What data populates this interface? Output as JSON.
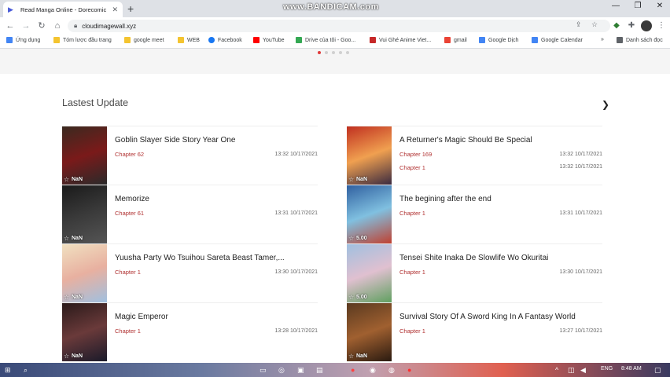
{
  "browser": {
    "tab_title": "Read Manga Online - Dorecomic",
    "new_tab_label": "+",
    "recorder_watermark": "www.BANDICAM.com",
    "url": "cloudimagewall.xyz",
    "bookmarks": [
      {
        "label": "Ứng dụng",
        "color": "#4285f4"
      },
      {
        "label": "Tóm lược đầu trang",
        "color": "#f4c430"
      },
      {
        "label": "google meet",
        "color": "#f4c430"
      },
      {
        "label": "WEB",
        "color": "#f4c430"
      },
      {
        "label": "Facebook",
        "color": "#1877f2"
      },
      {
        "label": "YouTube",
        "color": "#ff0000"
      },
      {
        "label": "Drive của tôi - Goo...",
        "color": "#34a853"
      },
      {
        "label": "Vui Ghé Anime Viet...",
        "color": "#c62828"
      },
      {
        "label": "gmail",
        "color": "#ea4335"
      },
      {
        "label": "Google Dịch",
        "color": "#4285f4"
      },
      {
        "label": "Google Calendar",
        "color": "#4285f4"
      }
    ],
    "bookmarks_overflow": "»",
    "reading_list": "Danh sách đọc"
  },
  "page": {
    "section_title": "Lastest Update",
    "carousel_active_index": 0,
    "carousel_dot_count": 5,
    "left_items": [
      {
        "title": "Goblin Slayer Side Story Year One",
        "chapter": "Chapter 62",
        "time": "13:32 10/17/2021",
        "rating": "NaN",
        "cover": [
          "#3a2a20",
          "#7a1a1a",
          "#2a2a2a"
        ]
      },
      {
        "title": "Memorize",
        "chapter": "Chapter 61",
        "time": "13:31 10/17/2021",
        "rating": "NaN",
        "cover": [
          "#1a1a1a",
          "#3a3a3a",
          "#555555"
        ]
      },
      {
        "title": "Yuusha Party Wo Tsuihou Sareta Beast Tamer,...",
        "chapter": "Chapter 1",
        "time": "13:30 10/17/2021",
        "rating": "NaN",
        "cover": [
          "#f0e0c0",
          "#e8b0a0",
          "#a0c0e0"
        ]
      },
      {
        "title": "Magic Emperor",
        "chapter": "Chapter 1",
        "time": "13:28 10/17/2021",
        "rating": "NaN",
        "cover": [
          "#2a1a1a",
          "#6a3a3a",
          "#1a1a2a"
        ]
      }
    ],
    "right_items": [
      {
        "title": "A Returner's Magic Should Be Special",
        "chapter": "Chapter 169",
        "chapter2": "Chapter 1",
        "time": "13:32 10/17/2021",
        "time2": "13:32 10/17/2021",
        "rating": "NaN",
        "cover": [
          "#c03020",
          "#f0a050",
          "#3a2a40"
        ]
      },
      {
        "title": "The begining after the end",
        "chapter": "Chapter 1",
        "time": "13:31 10/17/2021",
        "rating": "5.00",
        "cover": [
          "#3060a0",
          "#80c0e0",
          "#c04030"
        ]
      },
      {
        "title": "Tensei Shite Inaka De Slowlife Wo Okuritai",
        "chapter": "Chapter 1",
        "time": "13:30 10/17/2021",
        "rating": "5.00",
        "cover": [
          "#a0c0e0",
          "#e0c0d0",
          "#60a060"
        ]
      },
      {
        "title": "Survival Story Of A Sword King In A Fantasy World",
        "chapter": "Chapter 1",
        "time": "13:27 10/17/2021",
        "rating": "NaN",
        "cover": [
          "#5a3a20",
          "#a06030",
          "#2a1a10"
        ]
      }
    ]
  },
  "taskbar": {
    "language": "ENG",
    "clock": "8:48 AM"
  }
}
